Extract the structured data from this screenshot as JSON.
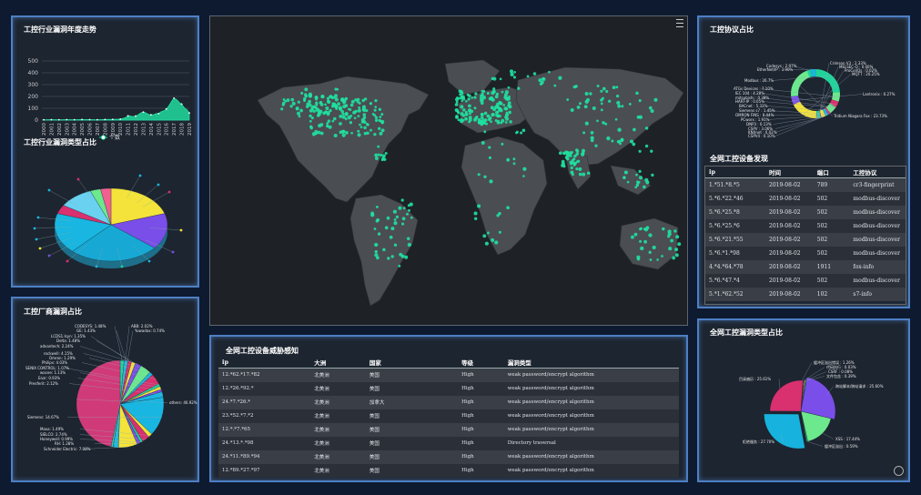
{
  "trend": {
    "title": "工控行业漏洞年度走势",
    "legend": "个数",
    "yticks": [
      "500",
      "400",
      "300",
      "200",
      "100",
      "0"
    ],
    "years": [
      "2000",
      "2001",
      "2002",
      "2003",
      "2004",
      "2005",
      "2006",
      "2007",
      "2008",
      "2009",
      "2010",
      "2011",
      "2012",
      "2013",
      "2014",
      "2015",
      "2016",
      "2017",
      "2018",
      "2019"
    ]
  },
  "industry": {
    "title": "工控行业漏洞类型占比"
  },
  "vendor": {
    "title": "工控厂商漏洞占比",
    "labels": [
      "CODESYS: 1.48%",
      "GE: 1.43%",
      "LCDS1.Isyn: 1.35%",
      "Delta: 1.48%",
      "advantech: 2.24%",
      "rockwell: 4.15%",
      "Omron: 1.29%",
      "Philips: 4.03%",
      "SENIX CONTROL: 1.07%",
      "wacee: 1.13%",
      "Enzr: 0.93%",
      "Presferit: 2.12%",
      "Siemens: 14.67%",
      "Moxa: 1.49%",
      "SIELCO: 2.74%",
      "Honeywell: 0.99%",
      "RH: 1.28%",
      "Schneider Electric: 7.08%",
      "ABB: 2.02%",
      "Yuwadax: 0.74%",
      "others: 46.92%"
    ]
  },
  "map": {
    "menu_icon": "menu-icon"
  },
  "threat": {
    "title": "全网工控设备威胁感知",
    "headers": [
      "ip",
      "大洲",
      "国家",
      "等级",
      "漏洞类型"
    ],
    "rows": [
      [
        "12.*62.*17.*82",
        "北美洲",
        "美国",
        "High",
        "weak password/encrypt algorithm"
      ],
      [
        "12.*26.*92.*",
        "北美洲",
        "美国",
        "High",
        "weak password/encrypt algorithm"
      ],
      [
        "24.*7.*26.*",
        "北美洲",
        "加拿大",
        "High",
        "weak password/encrypt algorithm"
      ],
      [
        "23.*52.*7.*2",
        "北美洲",
        "美国",
        "High",
        "weak password/encrypt algorithm"
      ],
      [
        "12.*.*7.*65",
        "北美洲",
        "美国",
        "High",
        "weak password/encrypt algorithm"
      ],
      [
        "24.*13.*.*98",
        "北美洲",
        "美国",
        "High",
        "Directory traversal"
      ],
      [
        "24.*11.*89.*94",
        "北美洲",
        "美国",
        "High",
        "weak password/encrypt algorithm"
      ],
      [
        "12.*89.*27.*97",
        "北美洲",
        "美国",
        "High",
        "weak password/encrypt algorithm"
      ]
    ]
  },
  "protocol": {
    "title": "工控协议占比",
    "labels": [
      "Codesys : 2.97%",
      "EtherNet/IP : 3.90%",
      "Modbus : 26.7%",
      "ATGs Devices : 7.10%",
      "IEC 104 : 4.28%",
      "mitsubishi : 0.38%",
      "HART-IP : 0.05%",
      "BACnet : 5.33%",
      "Siemens s7 : 1.45%",
      "OMRON FINS : 0.44%",
      "PCworx : 1.91%",
      "DNP3 : 0.13%",
      "CSPV : 3.06%",
      "KNXnet : 0.02%",
      "CSPV4 : 0.10%",
      "Crimson V3 : 2.33%",
      "MELSEC-Q : 0.00%",
      "ProConOs : 0.02%",
      "MQTT : 20.25%",
      "Lantronix : 6.27%",
      "Tridium Niagara Fox : 23.73%"
    ]
  },
  "discovery": {
    "title": "全网工控设备发现",
    "headers": [
      "ip",
      "时间",
      "端口",
      "工控协议"
    ],
    "rows": [
      [
        "1.*51.*8.*5",
        "2019-08-02",
        "789",
        "cr3-fingerprint"
      ],
      [
        "5.*6.*22.*46",
        "2019-08-02",
        "502",
        "modbus-discover"
      ],
      [
        "5.*6.*25.*8",
        "2019-08-02",
        "502",
        "modbus-discover"
      ],
      [
        "5.*6.*25.*6",
        "2019-08-02",
        "502",
        "modbus-discover"
      ],
      [
        "5.*6.*21.*55",
        "2019-08-02",
        "502",
        "modbus-discover"
      ],
      [
        "5.*6.*1.*98",
        "2019-08-02",
        "502",
        "modbus-discover"
      ],
      [
        "4.*4.*64.*78",
        "2019-08-02",
        "1911",
        "fox-info"
      ],
      [
        "5.*6.*47.*4",
        "2019-08-02",
        "502",
        "modbus-discover"
      ],
      [
        "5.*1.*62.*52",
        "2019-08-02",
        "102",
        "s7-info"
      ]
    ]
  },
  "vtype": {
    "title": "全网工控漏洞类型占比",
    "labels": [
      "缓冲区溢出错误 : 1.26%",
      "代码执行 : 0.03%",
      "CSRF : 0.08%",
      "文件包含 : 0.39%",
      "跨站脚本/跨站请求 : 25.60%",
      "XSS : 17.44%",
      "缓冲区溢出 : 0.59%",
      "拒绝服务 : 27.70%",
      "目录遍历 : 25.61%"
    ]
  },
  "colors": {
    "green": "#1fd39a",
    "pink": "#d9306f",
    "cyan": "#18b6e0",
    "yellow": "#f3e33a",
    "purple": "#7a4ee8",
    "lightgreen": "#6ce88d",
    "border": "#4e7fc4"
  }
}
